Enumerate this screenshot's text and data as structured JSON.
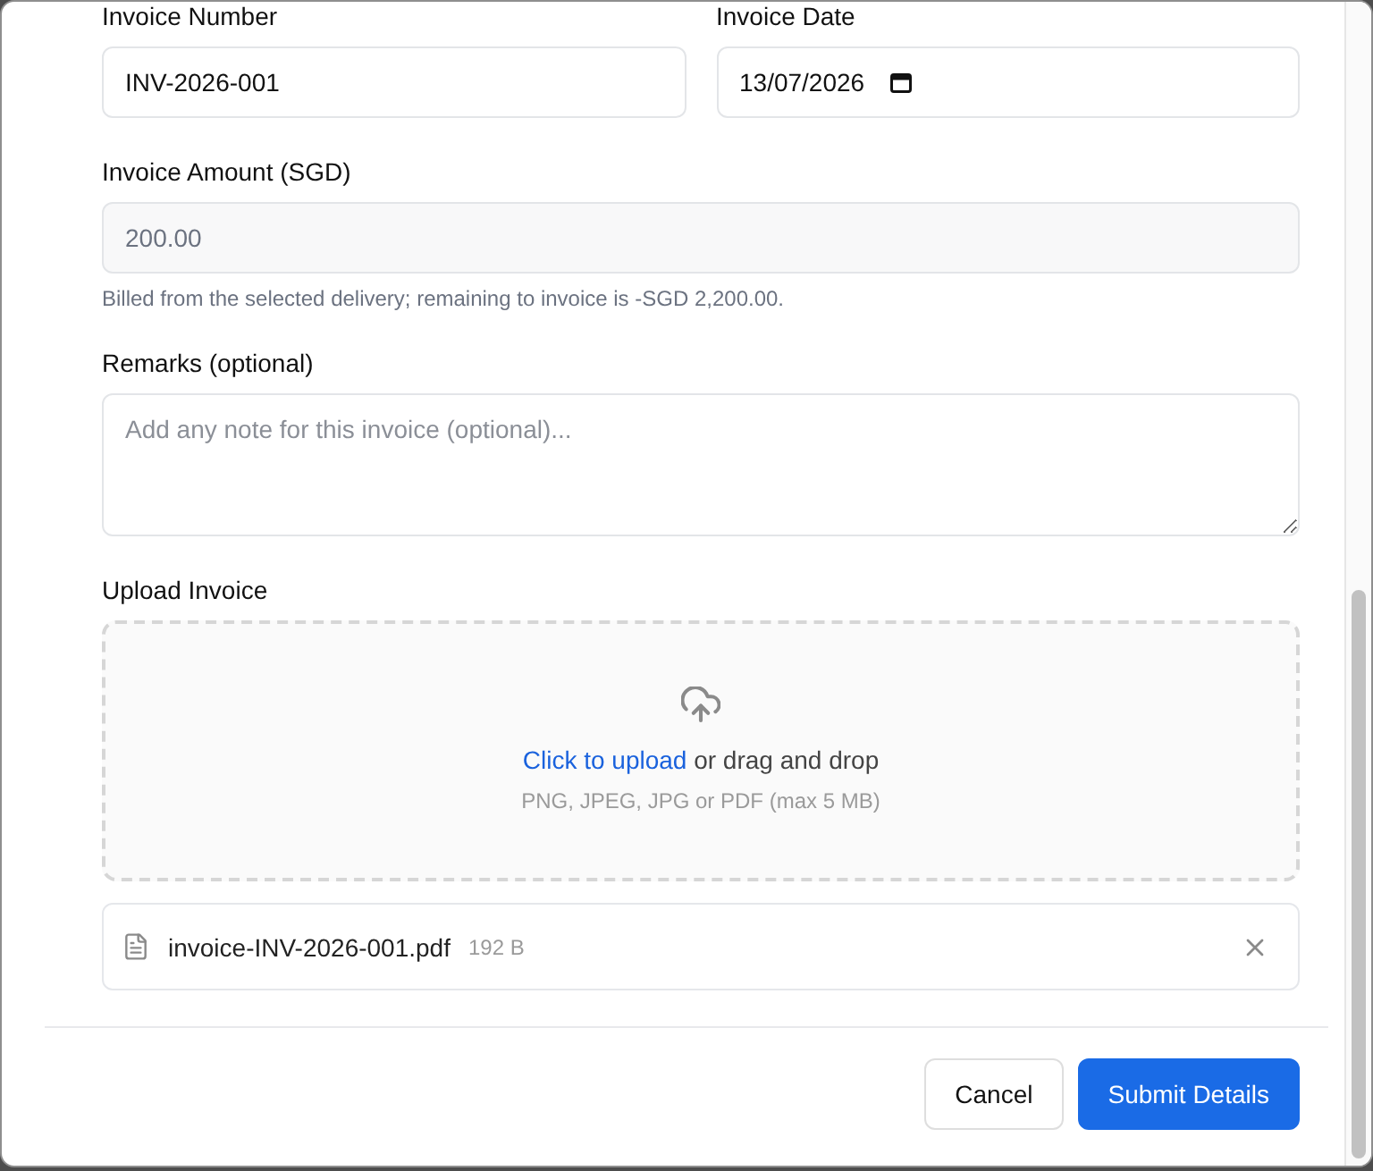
{
  "form": {
    "row": [
      {
        "kind": "text",
        "label": "Invoice Number",
        "value": "INV-2026-001"
      },
      {
        "kind": "date",
        "label": "Invoice Date",
        "value": "13/07/2026"
      }
    ],
    "amount": {
      "label": "Invoice Amount (SGD)",
      "value": "200.00",
      "disabled": true,
      "help": "Billed from the selected delivery; remaining to invoice is -SGD 2,200.00."
    },
    "remarks": {
      "label": "Remarks (optional)",
      "placeholder": "Add any note for this invoice (optional)..."
    },
    "upload": {
      "label": "Upload Invoice",
      "link": "Click to upload",
      "text": "or drag and drop",
      "hint": "PNG, JPEG, JPG or PDF (max 5 MB)",
      "files": [
        {
          "name": "invoice-INV-2026-001.pdf",
          "size": "192 B"
        }
      ]
    }
  },
  "buttons": [
    {
      "kind": "secondary",
      "label": "Cancel"
    },
    {
      "kind": "primary",
      "label": "Submit Details"
    }
  ]
}
